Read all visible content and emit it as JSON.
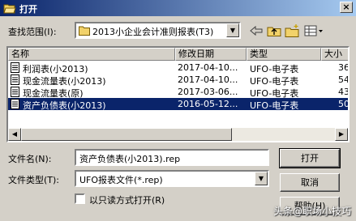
{
  "window": {
    "title": "打开",
    "close_glyph": "×"
  },
  "lookin": {
    "label": "查找范围(I):",
    "value": "2013小企业会计准则报表(T3)",
    "arrow": "▼"
  },
  "toolbar": {
    "icons": [
      "back-icon",
      "up-folder-icon",
      "new-folder-icon",
      "view-menu-icon"
    ]
  },
  "list": {
    "columns": [
      "名称",
      "修改日期",
      "类型",
      "大小"
    ],
    "rows": [
      {
        "name": "利润表(小2013)",
        "date": "2017-04-10...",
        "type": "UFO-电子表",
        "size": "36",
        "selected": false
      },
      {
        "name": "现金流量表(小2013)",
        "date": "2017-04-10...",
        "type": "UFO-电子表",
        "size": "54",
        "selected": false
      },
      {
        "name": "现金流量表(原)",
        "date": "2017-03-06...",
        "type": "UFO-电子表",
        "size": "43",
        "selected": false
      },
      {
        "name": "资产负债表(小2013)",
        "date": "2016-05-12...",
        "type": "UFO-电子表",
        "size": "50",
        "selected": true
      }
    ],
    "scroll_left": "◀",
    "scroll_right": "▶"
  },
  "filename": {
    "label": "文件名(N):",
    "value": "资产负债表(小2013).rep"
  },
  "filetype": {
    "label": "文件类型(T):",
    "value": "UFO报表文件(*.rep)",
    "arrow": "▼"
  },
  "readonly": {
    "label": "以只读方式打开(R)",
    "checked": false
  },
  "buttons": {
    "open": "打开",
    "cancel": "取消",
    "help": "帮助(H)"
  },
  "watermark": "头条@职场小技巧",
  "colors": {
    "title_start": "#0a246a",
    "title_end": "#a6caf0",
    "selection": "#0a246a",
    "face": "#d4d0c8"
  }
}
